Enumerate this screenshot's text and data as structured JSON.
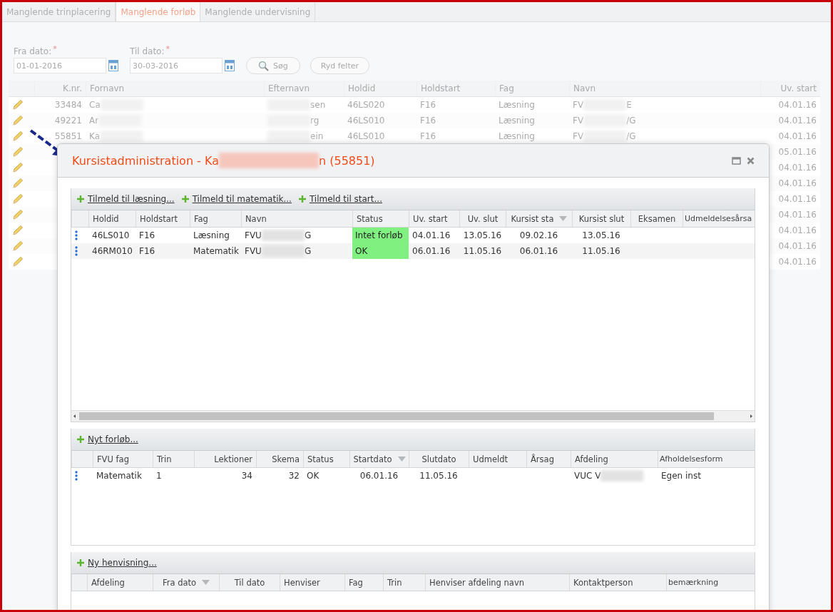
{
  "tabs": [
    {
      "label": "Manglende trinplacering",
      "selected": false
    },
    {
      "label": "Manglende forløb",
      "selected": true
    },
    {
      "label": "Manglende undervisning",
      "selected": false
    }
  ],
  "filters": [
    {
      "label": "Fra dato:",
      "required_mark": "*",
      "value": "01-01-2016"
    },
    {
      "label": "Til dato:",
      "required_mark": "*",
      "value": "30-03-2016"
    }
  ],
  "buttons": [
    {
      "kind": "search",
      "label": "Søg"
    },
    {
      "kind": "plain",
      "label": "Ryd felter"
    }
  ],
  "table": {
    "columns": [
      "K.nr.",
      "Fornavn",
      "Efternavn",
      "Holdid",
      "Holdstart",
      "Fag",
      "Navn",
      "Uv. start"
    ],
    "rows": [
      {
        "knr": "33484",
        "fornavn": {
          "start": "Ca"
        },
        "efternavn": {
          "end": "sen"
        },
        "holdid": "46LS020",
        "holdstart": "F16",
        "fag": "Læsning",
        "navn": {
          "start": "FV",
          "end": "E"
        },
        "uv_start": "04.01.16"
      },
      {
        "knr": "49221",
        "fornavn": {
          "start": "Ar"
        },
        "efternavn": {
          "end": "rg"
        },
        "holdid": "46LS010",
        "holdstart": "F16",
        "fag": "Læsning",
        "navn": {
          "start": "FV",
          "end": "/G"
        },
        "uv_start": "04.01.16"
      },
      {
        "knr": "55851",
        "fornavn": {
          "start": "Ka"
        },
        "efternavn": {
          "end": "ein"
        },
        "holdid": "46LS010",
        "holdstart": "F16",
        "fag": "Læsning",
        "navn": {
          "start": "FV",
          "end": "/G"
        },
        "uv_start": "04.01.16"
      },
      {
        "uv_start": "05.01.16"
      },
      {
        "uv_start": "04.01.16"
      },
      {
        "uv_start": "04.01.16"
      },
      {
        "uv_start": "04.01.16"
      },
      {
        "uv_start": "04.01.16"
      },
      {
        "uv_start": "04.01.16"
      },
      {
        "uv_start": "04.01.16"
      },
      {
        "uv_start": "04.01.16"
      }
    ]
  },
  "dialog": {
    "title": {
      "start": "Kursistadministration - Ka",
      "end": "n (55851)"
    },
    "panels": [
      {
        "actions": [
          "Tilmeld til læsning...",
          "Tilmeld til matematik...",
          "Tilmeld til start..."
        ],
        "horizontal_scrollbar": true,
        "columns": [
          {
            "label": "Holdid",
            "sorted": false
          },
          {
            "label": "Holdstart",
            "sorted": false
          },
          {
            "label": "Fag",
            "sorted": false
          },
          {
            "label": "Navn",
            "sorted": false
          },
          {
            "label": "Status",
            "sorted": false
          },
          {
            "label": "Uv. start",
            "sorted": false
          },
          {
            "label": "Uv. slut",
            "sorted": false
          },
          {
            "label": "Kursist sta",
            "sorted": true
          },
          {
            "label": "Kursist slut",
            "sorted": false
          },
          {
            "label": "Eksamen",
            "sorted": false
          },
          {
            "label": "Udmeldelsesårsa",
            "sorted": false
          }
        ],
        "rows": [
          {
            "cells": [
              "46LS010",
              "F16",
              "Læsning",
              {
                "start": "FVU",
                "end": "G"
              },
              {
                "text": "Intet forløb",
                "color": "#80f080"
              },
              "04.01.16",
              "13.05.16",
              "09.02.16",
              "13.05.16",
              "",
              ""
            ]
          },
          {
            "cells": [
              "46RM010",
              "F16",
              "Matematik",
              {
                "start": "FVU",
                "end": "G"
              },
              {
                "text": "OK",
                "color": "#80f080"
              },
              "06.01.16",
              "11.05.16",
              "06.01.16",
              "11.05.16",
              "",
              ""
            ]
          }
        ]
      },
      {
        "actions": [
          "Nyt forløb..."
        ],
        "horizontal_scrollbar": false,
        "columns": [
          {
            "label": "FVU fag",
            "sorted": false
          },
          {
            "label": "Trin",
            "sorted": false
          },
          {
            "label": "Lektioner",
            "sorted": false
          },
          {
            "label": "Skema",
            "sorted": false
          },
          {
            "label": "Status",
            "sorted": false
          },
          {
            "label": "Startdato",
            "sorted": true
          },
          {
            "label": "Slutdato",
            "sorted": false
          },
          {
            "label": "Udmeldt",
            "sorted": false
          },
          {
            "label": "Årsag",
            "sorted": false
          },
          {
            "label": "Afdeling",
            "sorted": false
          },
          {
            "label": "Afholdelsesform",
            "sorted": false
          }
        ],
        "rows": [
          {
            "cells": [
              "Matematik",
              "1",
              "34",
              "32",
              "OK",
              "06.01.16",
              "11.05.16",
              "",
              "",
              {
                "start": "VUC V"
              },
              "Egen inst"
            ]
          }
        ]
      },
      {
        "actions": [
          "Ny henvisning..."
        ],
        "horizontal_scrollbar": false,
        "columns": [
          {
            "label": "Afdeling",
            "sorted": false
          },
          {
            "label": "Fra dato",
            "sorted": true
          },
          {
            "label": "Til dato",
            "sorted": false
          },
          {
            "label": "Henviser",
            "sorted": false
          },
          {
            "label": "Fag",
            "sorted": false
          },
          {
            "label": "Trin",
            "sorted": false
          },
          {
            "label": "Henviser afdeling navn",
            "sorted": false
          },
          {
            "label": "Kontaktperson",
            "sorted": false
          },
          {
            "label": "bemærkning",
            "sorted": false
          }
        ]
      }
    ]
  }
}
